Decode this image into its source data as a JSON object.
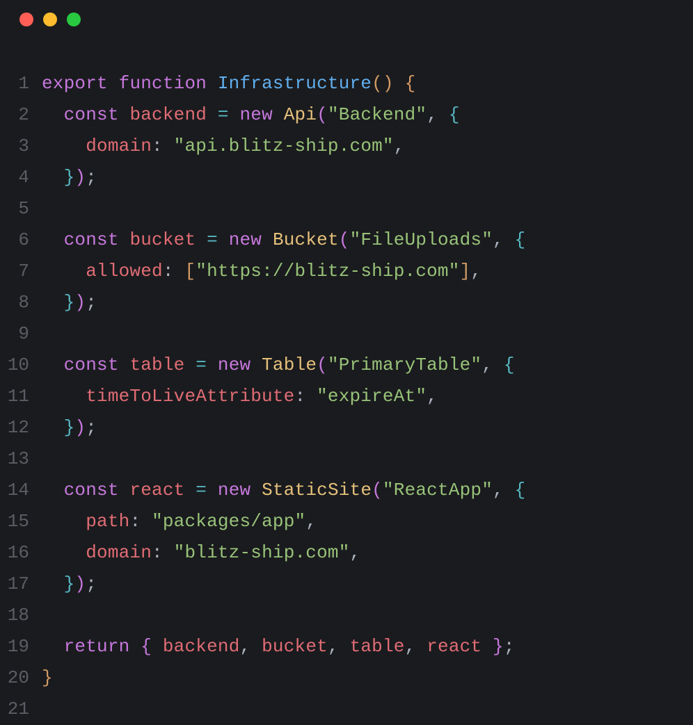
{
  "titlebar": {
    "close": "close",
    "minimize": "minimize",
    "maximize": "maximize"
  },
  "gutter": [
    "1",
    "2",
    "3",
    "4",
    "5",
    "6",
    "7",
    "8",
    "9",
    "10",
    "11",
    "12",
    "13",
    "14",
    "15",
    "16",
    "17",
    "18",
    "19",
    "20",
    "21"
  ],
  "tokens": {
    "export": "export",
    "function": "function",
    "Infrastructure": "Infrastructure",
    "const": "const",
    "backend": "backend",
    "bucket": "bucket",
    "table": "table",
    "react": "react",
    "new": "new",
    "Api": "Api",
    "Bucket": "Bucket",
    "Table": "Table",
    "StaticSite": "StaticSite",
    "return": "return",
    "domain": "domain",
    "allowed": "allowed",
    "timeToLiveAttribute": "timeToLiveAttribute",
    "path": "path",
    "str_Backend": "\"Backend\"",
    "str_api_domain": "\"api.blitz-ship.com\"",
    "str_FileUploads": "\"FileUploads\"",
    "str_https": "\"https://blitz-ship.com\"",
    "str_PrimaryTable": "\"PrimaryTable\"",
    "str_expireAt": "\"expireAt\"",
    "str_ReactApp": "\"ReactApp\"",
    "str_packages": "\"packages/app\"",
    "str_blitz": "\"blitz-ship.com\"",
    "paren_open": "(",
    "paren_close": ")",
    "brace_open": "{",
    "brace_close": "}",
    "bracket_open": "[",
    "bracket_close": "]",
    "comma": ",",
    "semi": ";",
    "colon": ":",
    "eq": "=",
    "sp": " ",
    "sp2": "  ",
    "sp4": "    "
  }
}
